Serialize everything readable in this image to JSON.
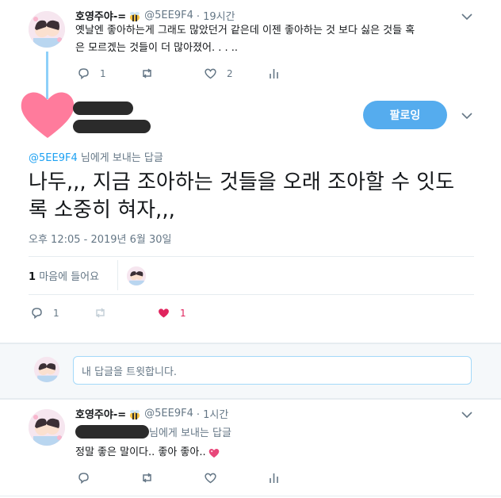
{
  "tweet1": {
    "name": "호영주야-=",
    "handle": "@5EE9F4",
    "time": "· 19시간",
    "text": "옛날엔 좋아하는게 그래도 많았던거 같은데 이젠 좋아하는 것 보다 싫은 것들 혹은 모르겠는 것들이 더 많아졌어. . . ..",
    "reply_count": "1",
    "like_count": "2"
  },
  "main": {
    "follow_label": "팔로잉",
    "reply_to_handle": "@5EE9F4",
    "reply_to_suffix": "님에게 보내는 답글",
    "text": "나두,,, 지금 조아하는 것들을 오래 조아할 수 잇도록 소중히 혀자,,,",
    "timestamp": "오후 12:05 - 2019년 6월 30일",
    "likes_count": "1",
    "likes_label": "마음에 들어요",
    "reply_count": "1",
    "like_count": "1"
  },
  "compose": {
    "placeholder": "내 답글을 트윗합니다."
  },
  "tweet2": {
    "name": "호영주야-=",
    "handle": "@5EE9F4",
    "time": "· 1시간",
    "reply_suffix": "님에게 보내는 답글",
    "text": "정말 좋은 말이다.. 좋아 좋아.."
  },
  "colors": {
    "accent": "#1da1f2",
    "follow_button": "#55acee",
    "like_active": "#e0245e",
    "heart_sticker": "#ff7b9c",
    "thread_line": "#8ed0f9"
  }
}
